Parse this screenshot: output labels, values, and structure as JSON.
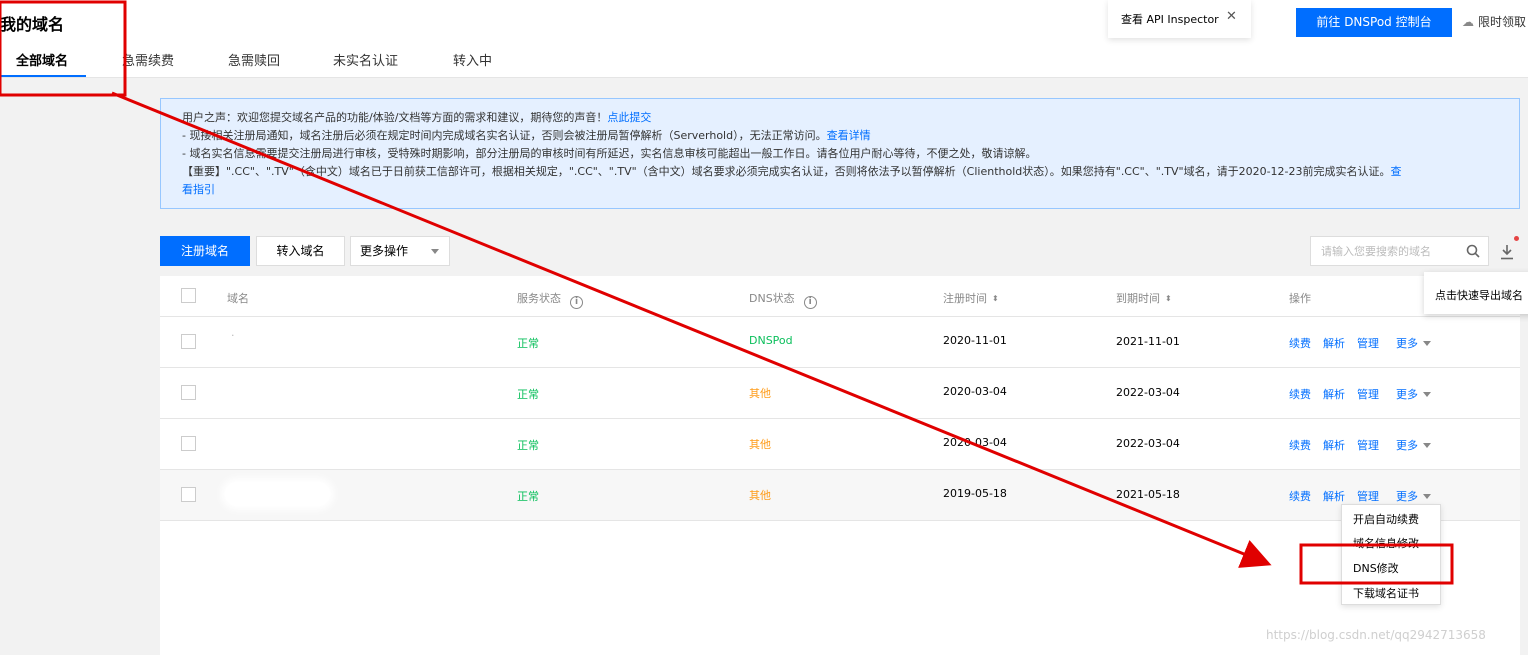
{
  "header": {
    "title": "我的域名",
    "tabs": [
      {
        "label": "全部域名",
        "active": true
      },
      {
        "label": "急需续费"
      },
      {
        "label": "急需赎回"
      },
      {
        "label": "未实名认证"
      },
      {
        "label": "转入中"
      }
    ],
    "api_inspector": "查看 API Inspector",
    "close_glyph": "✕",
    "dnspod_button": "前往 DNSPod 控制台",
    "promo_text": "限时领取"
  },
  "notice": {
    "line1": "用户之声：欢迎您提交域名产品的功能/体验/文档等方面的需求和建议，期待您的声音！",
    "line1_link": "点此提交",
    "line2": "- 现接相关注册局通知，域名注册后必须在规定时间内完成域名实名认证，否则会被注册局暂停解析（Serverhold），无法正常访问。",
    "line2_link": "查看详情",
    "line3": "- 域名实名信息需要提交注册局进行审核，受特殊时期影响，部分注册局的审核时间有所延迟，实名信息审核可能超出一般工作日。请各位用户耐心等待，不便之处，敬请谅解。",
    "line4": "【重要】\".CC\"、\".TV\"（含中文）域名已于日前获工信部许可，根据相关规定，\".CC\"、\".TV\"（含中文）域名要求必须完成实名认证，否则将依法予以暂停解析（Clienthold状态）。如果您持有\".CC\"、\".TV\"域名，请于2020-12-23前完成实名认证。",
    "line4_link_a": "查",
    "line4_link_b": "看指引"
  },
  "toolbar": {
    "register": "注册域名",
    "transfer": "转入域名",
    "more_ops": "更多操作",
    "search_placeholder": "请输入您要搜索的域名",
    "export_tooltip": "点击快速导出域名"
  },
  "table": {
    "columns": [
      "域名",
      "服务状态",
      "DNS状态",
      "注册时间",
      "到期时间",
      "操作"
    ],
    "info_glyph": "i",
    "sort_glyph": "⬍",
    "rows": [
      {
        "name": "·",
        "status": "正常",
        "dns": "DNSPod",
        "reg": "2020-11-01",
        "exp": "2021-11-01"
      },
      {
        "name": "",
        "status": "正常",
        "dns": "其他",
        "reg": "2020-03-04",
        "exp": "2022-03-04"
      },
      {
        "name": "",
        "status": "正常",
        "dns": "其他",
        "reg": "2020-03-04",
        "exp": "2022-03-04"
      },
      {
        "name": "",
        "status": "正常",
        "dns": "其他",
        "reg": "2019-05-18",
        "exp": "2021-05-18"
      }
    ],
    "ops": {
      "renew": "续费",
      "resolve": "解析",
      "manage": "管理",
      "more": "更多"
    }
  },
  "dropdown": {
    "items": [
      "开启自动续费",
      "域名信息修改",
      "DNS修改",
      "下载域名证书"
    ]
  },
  "watermark": "https://blog.csdn.net/qq2942713658",
  "colors": {
    "primary": "#006eff",
    "ok": "#0abf5b",
    "warn": "#ff9c19",
    "annotation": "#e00000"
  }
}
